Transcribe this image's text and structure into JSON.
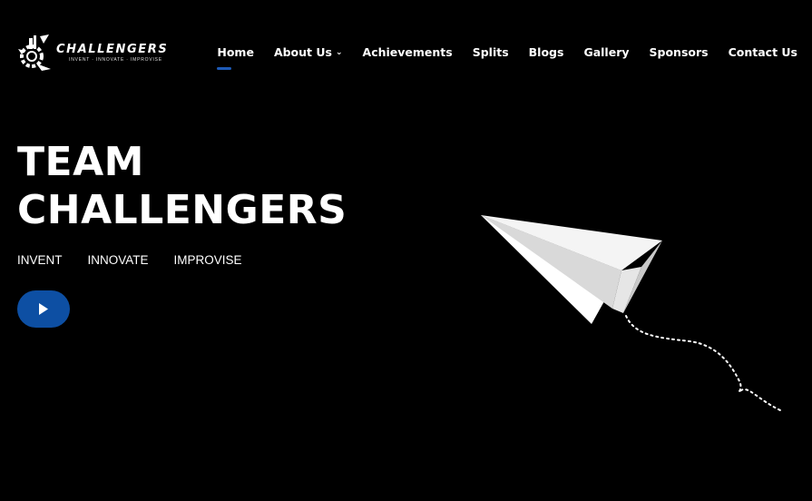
{
  "brand": {
    "name": "CHALLENGERS",
    "tagline": "INVENT · INNOVATE · IMPROVISE"
  },
  "nav": {
    "items": [
      {
        "label": "Home",
        "active": true
      },
      {
        "label": "About Us",
        "has_dropdown": true
      },
      {
        "label": "Achievements"
      },
      {
        "label": "Splits"
      },
      {
        "label": "Blogs"
      },
      {
        "label": "Gallery"
      },
      {
        "label": "Sponsors"
      },
      {
        "label": "Contact Us"
      }
    ]
  },
  "hero": {
    "title_line1": "TEAM",
    "title_line2": "CHALLENGERS",
    "taglines": [
      "INVENT",
      "INNOVATE",
      "IMPROVISE"
    ],
    "play_icon": "play-icon"
  },
  "colors": {
    "background": "#000000",
    "accent": "#1e5bb8",
    "button": "#0d4fa3",
    "text": "#ffffff"
  }
}
